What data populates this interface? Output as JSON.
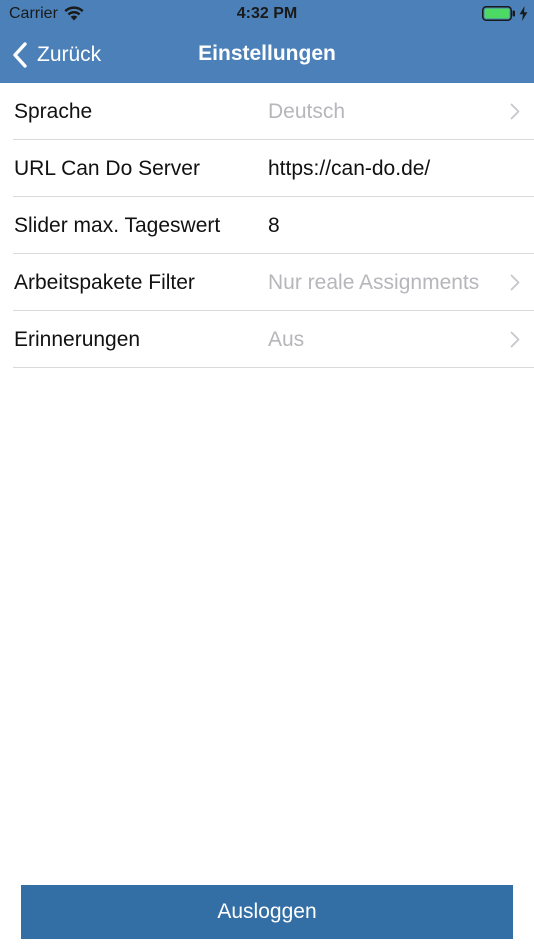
{
  "status_bar": {
    "carrier": "Carrier",
    "time": "4:32 PM",
    "icons": [
      "wifi-icon",
      "battery-icon",
      "charging-bolt-icon"
    ]
  },
  "nav_bar": {
    "back_label": "Zurück",
    "back_icon": "chevron-left-icon",
    "title": "Einstellungen"
  },
  "settings": {
    "rows": [
      {
        "label": "Sprache",
        "value": "Deutsch",
        "value_style": "muted",
        "chevron": true
      },
      {
        "label": "URL Can Do Server",
        "value": "https://can-do.de/",
        "value_style": "dark",
        "chevron": false
      },
      {
        "label": "Slider max. Tageswert",
        "value": "8",
        "value_style": "dark",
        "chevron": false
      },
      {
        "label": "Arbeitspakete Filter",
        "value": "Nur reale Assignments",
        "value_style": "muted",
        "chevron": true
      },
      {
        "label": "Erinnerungen",
        "value": "Aus",
        "value_style": "muted",
        "chevron": true
      }
    ]
  },
  "footer": {
    "logout_label": "Ausloggen"
  },
  "colors": {
    "nav_background": "#4b81b8",
    "button_background": "#336ea5",
    "muted_text": "#b6b6bb",
    "battery_fill": "#4cd964"
  }
}
